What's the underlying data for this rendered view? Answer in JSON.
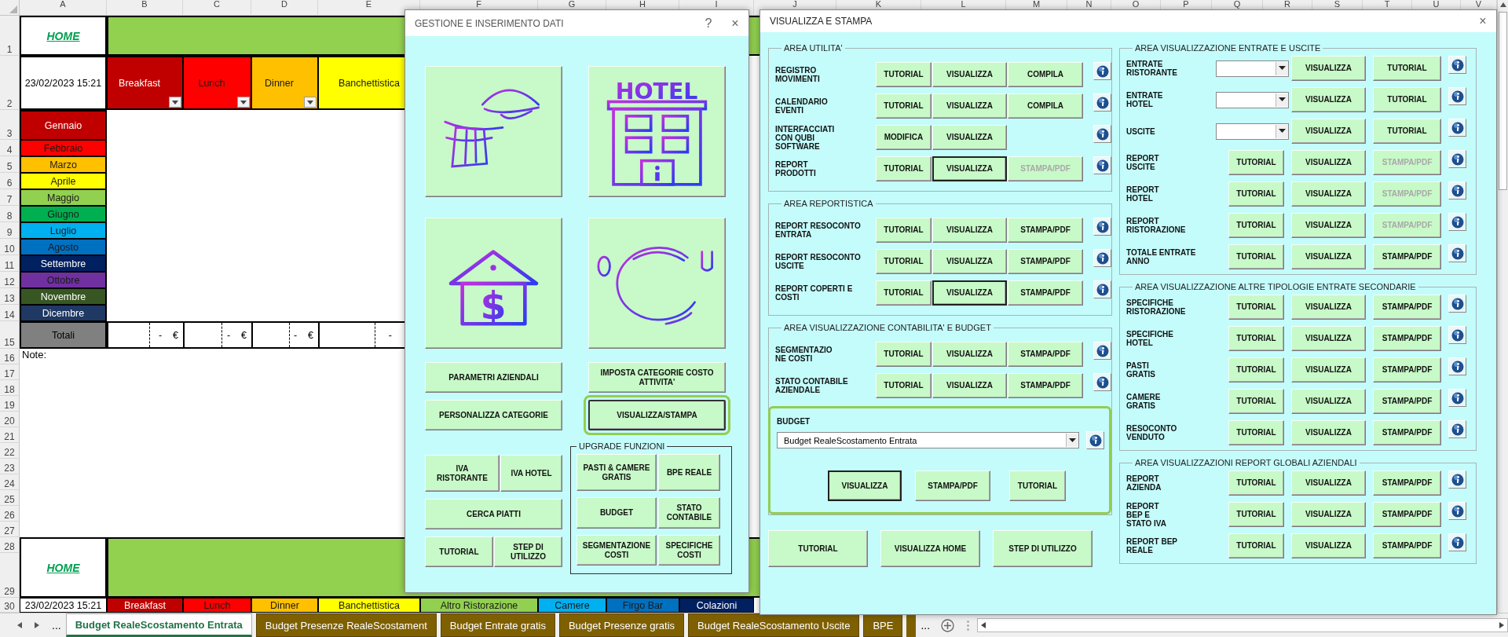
{
  "sheet": {
    "columns": [
      "A",
      "B",
      "C",
      "D",
      "E",
      "F",
      "G",
      "H",
      "I",
      "J",
      "K",
      "L",
      "M",
      "N",
      "O",
      "P",
      "Q",
      "R",
      "S",
      "T",
      "U",
      "V"
    ],
    "rows": [
      "1",
      "2",
      "3",
      "4",
      "5",
      "6",
      "7",
      "8",
      "9",
      "10",
      "11",
      "12",
      "13",
      "14",
      "15",
      "16",
      "17",
      "18",
      "19",
      "20",
      "21",
      "22",
      "23",
      "24",
      "25",
      "26",
      "27",
      "28",
      "29",
      "30"
    ],
    "header_link": "HOME",
    "timestamp": "23/02/2023 15:21",
    "meals": [
      {
        "label": "Breakfast",
        "color": "#c00000",
        "filter": true
      },
      {
        "label": "Lunch",
        "color": "#ff0000",
        "filter": true
      },
      {
        "label": "Dinner",
        "color": "#ffc000",
        "filter": true
      },
      {
        "label": "Banchettistica",
        "color": "#ffff00",
        "filter": false
      }
    ],
    "months": [
      {
        "label": "Gennaio",
        "color": "#c00000"
      },
      {
        "label": "Febbraio",
        "color": "#ff0000"
      },
      {
        "label": "Marzo",
        "color": "#ffc000"
      },
      {
        "label": "Aprile",
        "color": "#ffff00"
      },
      {
        "label": "Maggio",
        "color": "#92d050"
      },
      {
        "label": "Giugno",
        "color": "#00b050"
      },
      {
        "label": "Luglio",
        "color": "#00b0f0"
      },
      {
        "label": "Agosto",
        "color": "#0070c0"
      },
      {
        "label": "Settembre",
        "color": "#002060"
      },
      {
        "label": "Ottobre",
        "color": "#7030a0"
      },
      {
        "label": "Novembre",
        "color": "#375623"
      },
      {
        "label": "Dicembre",
        "color": "#1f3864"
      }
    ],
    "totals_label": "Totali",
    "totals": [
      {
        "value": "-",
        "currency": "€"
      },
      {
        "value": "-",
        "currency": "€"
      },
      {
        "value": "-",
        "currency": "€"
      },
      {
        "value": "-"
      }
    ],
    "note_label": "Note:",
    "footer_link": "HOME",
    "footer_timestamp": "23/02/2023 15:21",
    "footer_meals": [
      {
        "label": "Breakfast",
        "color": "#c00000"
      },
      {
        "label": "Lunch",
        "color": "#ff0000"
      },
      {
        "label": "Dinner",
        "color": "#ffc000"
      },
      {
        "label": "Banchettistica",
        "color": "#ffff00"
      },
      {
        "label": "Altro Ristorazione",
        "color": "#92d050"
      },
      {
        "label": "Camere",
        "color": "#00b0f0"
      },
      {
        "label": "Firgo Bar",
        "color": "#0070c0"
      },
      {
        "label": "Colazioni",
        "color": "#002060"
      }
    ]
  },
  "tabs": {
    "more_left": "...",
    "more_right": "...",
    "items": [
      {
        "label": "Budget RealeScostamento Entrata",
        "selected": true
      },
      {
        "label": "Budget Presenze RealeScostament",
        "selected": false
      },
      {
        "label": "Budget Entrate gratis",
        "selected": false
      },
      {
        "label": "Budget Presenze gratis",
        "selected": false
      },
      {
        "label": "Budget RealeScostamento Uscite",
        "selected": false
      },
      {
        "label": "BPE",
        "selected": false
      }
    ]
  },
  "data_dialog": {
    "title": "GESTIONE E INSERIMENTO DATI",
    "help": "?",
    "close": "×",
    "tiles": [
      {
        "kind": "waiter"
      },
      {
        "kind": "hotel",
        "caption": "HOTEL"
      },
      {
        "kind": "money-house",
        "caption": "$"
      },
      {
        "kind": "plate"
      }
    ],
    "main_buttons": [
      {
        "label": "PARAMETRI AZIENDALI",
        "highlighted": false
      },
      {
        "label": "IMPOSTA CATEGORIE COSTO\nATTIVITA'",
        "highlighted": false
      },
      {
        "label": "PERSONALIZZA CATEGORIE",
        "highlighted": false
      },
      {
        "label": "VISUALIZZA/STAMPA",
        "highlighted": true
      }
    ],
    "left_rows": [
      [
        {
          "label": "IVA\nRISTORANTE",
          "highlighted": false
        },
        {
          "label": "IVA HOTEL",
          "highlighted": false
        }
      ],
      [
        {
          "label": "CERCA PIATTI",
          "highlighted": false
        }
      ],
      [
        {
          "label": "TUTORIAL",
          "highlighted": false
        },
        {
          "label": "STEP DI\nUTILIZZO",
          "highlighted": false
        }
      ]
    ],
    "upgrade": {
      "title": "UPGRADE FUNZIONI",
      "rows": [
        [
          {
            "label": "PASTI & CAMERE\nGRATIS",
            "highlighted": false
          },
          {
            "label": "BPE REALE",
            "highlighted": false
          }
        ],
        [
          {
            "label": "BUDGET",
            "highlighted": false
          },
          {
            "label": "STATO\nCONTABILE",
            "highlighted": false
          }
        ],
        [
          {
            "label": "SEGMENTAZIONE\nCOSTI",
            "highlighted": false
          },
          {
            "label": "SPECIFICHE\nCOSTI",
            "highlighted": false
          }
        ]
      ]
    }
  },
  "print_dialog": {
    "title": "VISUALIZZA E STAMPA",
    "close": "×",
    "left_sections": [
      {
        "title": "AREA UTILITA'",
        "rows": [
          {
            "label": "REGISTRO\nMOVIMENTI",
            "buttons": [
              {
                "label": "TUTORIAL",
                "disabled": false,
                "focused": false
              },
              {
                "label": "VISUALIZZA",
                "disabled": false,
                "focused": false
              },
              {
                "label": "COMPILA",
                "disabled": false,
                "focused": false
              }
            ]
          },
          {
            "label": "CALENDARIO\nEVENTI",
            "buttons": [
              {
                "label": "TUTORIAL",
                "disabled": false,
                "focused": false
              },
              {
                "label": "VISUALIZZA",
                "disabled": false,
                "focused": false
              },
              {
                "label": "COMPILA",
                "disabled": false,
                "focused": false
              }
            ]
          },
          {
            "label": "INTERFACCIATI\nCON QUBI\nSOFTWARE",
            "buttons": [
              {
                "label": "MODIFICA",
                "disabled": false,
                "focused": false
              },
              {
                "label": "VISUALIZZA",
                "disabled": false,
                "focused": false
              }
            ]
          },
          {
            "label": "REPORT\nPRODOTTI",
            "buttons": [
              {
                "label": "TUTORIAL",
                "disabled": false,
                "focused": false
              },
              {
                "label": "VISUALIZZA",
                "disabled": false,
                "focused": true
              },
              {
                "label": "STAMPA/PDF",
                "disabled": true,
                "focused": false
              }
            ]
          }
        ]
      },
      {
        "title": "AREA REPORTISTICA",
        "rows": [
          {
            "label": "REPORT RESOCONTO\nENTRATA",
            "buttons": [
              {
                "label": "TUTORIAL",
                "disabled": false,
                "focused": false
              },
              {
                "label": "VISUALIZZA",
                "disabled": false,
                "focused": false
              },
              {
                "label": "STAMPA/PDF",
                "disabled": false,
                "focused": false
              }
            ]
          },
          {
            "label": "REPORT RESOCONTO\nUSCITE",
            "buttons": [
              {
                "label": "TUTORIAL",
                "disabled": false,
                "focused": false
              },
              {
                "label": "VISUALIZZA",
                "disabled": false,
                "focused": false
              },
              {
                "label": "STAMPA/PDF",
                "disabled": false,
                "focused": false
              }
            ]
          },
          {
            "label": "REPORT COPERTI E\nCOSTI",
            "buttons": [
              {
                "label": "TUTORIAL",
                "disabled": false,
                "focused": false
              },
              {
                "label": "VISUALIZZA",
                "disabled": false,
                "focused": true
              },
              {
                "label": "STAMPA/PDF",
                "disabled": false,
                "focused": false
              }
            ]
          }
        ]
      },
      {
        "title": "AREA VISUALIZZAZIONE CONTABILITA' E BUDGET",
        "rows": [
          {
            "label": "SEGMENTAZIO\nNE COSTI",
            "buttons": [
              {
                "label": "TUTORIAL",
                "disabled": false,
                "focused": false
              },
              {
                "label": "VISUALIZZA",
                "disabled": false,
                "focused": false
              },
              {
                "label": "STAMPA/PDF",
                "disabled": false,
                "focused": false
              }
            ]
          },
          {
            "label": "STATO CONTABILE\nAZIENDALE",
            "buttons": [
              {
                "label": "TUTORIAL",
                "disabled": false,
                "focused": false
              },
              {
                "label": "VISUALIZZA",
                "disabled": false,
                "focused": false
              },
              {
                "label": "STAMPA/PDF",
                "disabled": false,
                "focused": false
              }
            ]
          }
        ],
        "budget": {
          "label": "BUDGET",
          "value": "Budget RealeScostamento Entrata",
          "highlighted": true,
          "buttons": [
            {
              "label": "VISUALIZZA",
              "disabled": false,
              "focused": true
            },
            {
              "label": "STAMPA/PDF",
              "disabled": false,
              "focused": false
            },
            {
              "label": "TUTORIAL",
              "disabled": false,
              "focused": false
            }
          ]
        }
      }
    ],
    "footer_buttons": [
      {
        "label": "TUTORIAL",
        "disabled": false,
        "focused": false
      },
      {
        "label": "VISUALIZZA HOME",
        "disabled": false,
        "focused": false
      },
      {
        "label": "STEP DI UTILIZZO",
        "disabled": false,
        "focused": false
      }
    ],
    "right_sections": [
      {
        "title": "AREA VISUALIZZAZIONE ENTRATE E USCITE",
        "rows": [
          {
            "kind": "combo",
            "label": "ENTRATE\nRISTORANTE",
            "buttons": [
              {
                "label": "VISUALIZZA",
                "disabled": false,
                "focused": false
              },
              {
                "label": "TUTORIAL",
                "disabled": false,
                "focused": false
              }
            ]
          },
          {
            "kind": "combo",
            "label": "ENTRATE\nHOTEL",
            "buttons": [
              {
                "label": "VISUALIZZA",
                "disabled": false,
                "focused": false
              },
              {
                "label": "TUTORIAL",
                "disabled": false,
                "focused": false
              }
            ]
          },
          {
            "kind": "combo",
            "label": "USCITE",
            "buttons": [
              {
                "label": "VISUALIZZA",
                "disabled": false,
                "focused": false
              },
              {
                "label": "TUTORIAL",
                "disabled": false,
                "focused": false
              }
            ]
          },
          {
            "kind": "buttons",
            "label": "REPORT\nUSCITE",
            "buttons": [
              {
                "label": "TUTORIAL",
                "disabled": false,
                "focused": false
              },
              {
                "label": "VISUALIZZA",
                "disabled": false,
                "focused": false
              },
              {
                "label": "STAMPA/PDF",
                "disabled": true,
                "focused": false
              }
            ]
          },
          {
            "kind": "buttons",
            "label": "REPORT\nHOTEL",
            "buttons": [
              {
                "label": "TUTORIAL",
                "disabled": false,
                "focused": false
              },
              {
                "label": "VISUALIZZA",
                "disabled": false,
                "focused": false
              },
              {
                "label": "STAMPA/PDF",
                "disabled": true,
                "focused": false
              }
            ]
          },
          {
            "kind": "buttons",
            "label": "REPORT\nRISTORAZIONE",
            "buttons": [
              {
                "label": "TUTORIAL",
                "disabled": false,
                "focused": false
              },
              {
                "label": "VISUALIZZA",
                "disabled": false,
                "focused": false
              },
              {
                "label": "STAMPA/PDF",
                "disabled": true,
                "focused": false
              }
            ]
          },
          {
            "kind": "buttons",
            "label": "TOTALE ENTRATE\nANNO",
            "buttons": [
              {
                "label": "TUTORIAL",
                "disabled": false,
                "focused": false
              },
              {
                "label": "VISUALIZZA",
                "disabled": false,
                "focused": false
              },
              {
                "label": "STAMPA/PDF",
                "disabled": false,
                "focused": false
              }
            ]
          }
        ]
      },
      {
        "title": "AREA VISUALIZZAZIONE ALTRE TIPOLOGIE ENTRATE SECONDARIE",
        "rows": [
          {
            "kind": "buttons",
            "label": "SPECIFICHE\nRISTORAZIONE",
            "buttons": [
              {
                "label": "TUTORIAL",
                "disabled": false,
                "focused": false
              },
              {
                "label": "VISUALIZZA",
                "disabled": false,
                "focused": false
              },
              {
                "label": "STAMPA/PDF",
                "disabled": false,
                "focused": false
              }
            ]
          },
          {
            "kind": "buttons",
            "label": "SPECIFICHE\nHOTEL",
            "buttons": [
              {
                "label": "TUTORIAL",
                "disabled": false,
                "focused": false
              },
              {
                "label": "VISUALIZZA",
                "disabled": false,
                "focused": false
              },
              {
                "label": "STAMPA/PDF",
                "disabled": false,
                "focused": false
              }
            ]
          },
          {
            "kind": "buttons",
            "label": "PASTI\nGRATIS",
            "buttons": [
              {
                "label": "TUTORIAL",
                "disabled": false,
                "focused": false
              },
              {
                "label": "VISUALIZZA",
                "disabled": false,
                "focused": false
              },
              {
                "label": "STAMPA/PDF",
                "disabled": false,
                "focused": false
              }
            ]
          },
          {
            "kind": "buttons",
            "label": "CAMERE\nGRATIS",
            "buttons": [
              {
                "label": "TUTORIAL",
                "disabled": false,
                "focused": false
              },
              {
                "label": "VISUALIZZA",
                "disabled": false,
                "focused": false
              },
              {
                "label": "STAMPA/PDF",
                "disabled": false,
                "focused": false
              }
            ]
          },
          {
            "kind": "buttons",
            "label": "RESOCONTO\nVENDUTO",
            "buttons": [
              {
                "label": "TUTORIAL",
                "disabled": false,
                "focused": false
              },
              {
                "label": "VISUALIZZA",
                "disabled": false,
                "focused": false
              },
              {
                "label": "STAMPA/PDF",
                "disabled": false,
                "focused": false
              }
            ]
          }
        ]
      },
      {
        "title": "AREA VISUALIZZAZIONI REPORT GLOBALI AZIENDALI",
        "rows": [
          {
            "kind": "buttons",
            "label": "REPORT\nAZIENDA",
            "buttons": [
              {
                "label": "TUTORIAL",
                "disabled": false,
                "focused": false
              },
              {
                "label": "VISUALIZZA",
                "disabled": false,
                "focused": false
              },
              {
                "label": "STAMPA/PDF",
                "disabled": false,
                "focused": false
              }
            ]
          },
          {
            "kind": "buttons",
            "label": "REPORT\nBEP E\nSTATO IVA",
            "buttons": [
              {
                "label": "TUTORIAL",
                "disabled": false,
                "focused": false
              },
              {
                "label": "VISUALIZZA",
                "disabled": false,
                "focused": false
              },
              {
                "label": "STAMPA/PDF",
                "disabled": false,
                "focused": false
              }
            ]
          },
          {
            "kind": "buttons",
            "label": "REPORT BEP\nREALE",
            "buttons": [
              {
                "label": "TUTORIAL",
                "disabled": false,
                "focused": false
              },
              {
                "label": "VISUALIZZA",
                "disabled": false,
                "focused": false
              },
              {
                "label": "STAMPA/PDF",
                "disabled": false,
                "focused": false
              }
            ]
          }
        ]
      }
    ]
  }
}
